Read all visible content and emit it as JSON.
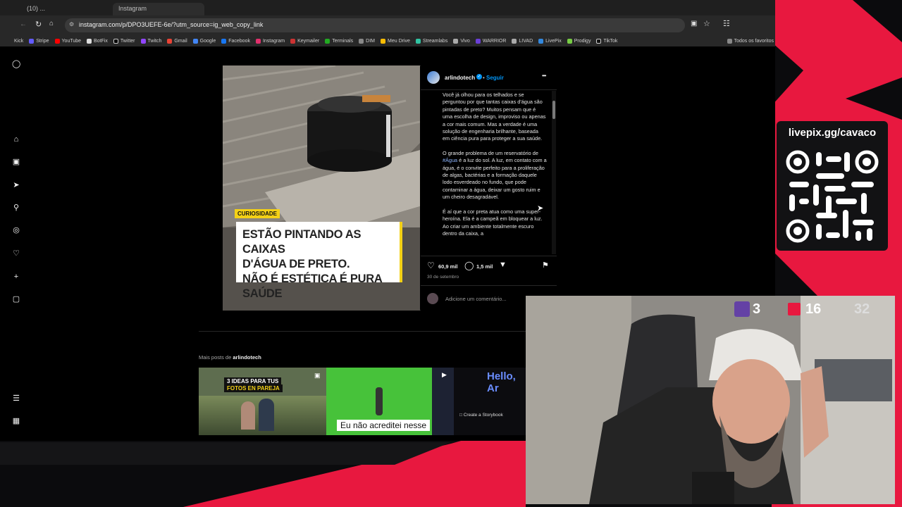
{
  "browser": {
    "tabs": [
      "(10) ...",
      "Instagram"
    ],
    "url": "instagram.com/p/DPO3UEFE-6e/?utm_source=ig_web_copy_link",
    "bookmarks": [
      "Kick",
      "Stripe",
      "YouTube",
      "BotFix",
      "Twitter",
      "Twitch",
      "Gmail",
      "Google",
      "Facebook",
      "Instagram",
      "Keymailer",
      "Terminals",
      "DIM",
      "Meu Drive",
      "Streamlabs",
      "Vivo",
      "WARRIOR",
      "LIVAD",
      "LivePix",
      "Prodigy",
      "TikTok"
    ],
    "all_favorites": "Todos os favoritos"
  },
  "post": {
    "username": "arlindotech",
    "follow": "Seguir",
    "more": "•••",
    "image_tag": "CURIOSIDADE",
    "image_headline_1": "ESTÃO PINTANDO AS CAIXAS",
    "image_headline_2": "D'ÁGUA DE PRETO.",
    "image_headline_3": "NÃO É ESTÉTICA É PURA SAÚDE",
    "caption_p1": "Você já olhou para os telhados e se perguntou por que tantas caixas d'água são pintadas de preto? Muitos pensam que é uma escolha de design, improviso ou apenas a cor mais comum. Mas a verdade é uma solução de engenharia brilhante, baseada em ciência pura para proteger a sua saúde.",
    "caption_p2_a": "O grande problema de um reservatório de ",
    "caption_p2_tag": "#Água",
    "caption_p2_b": " é a luz do sol. A luz, em contato com a água, é o convite perfeito para a proliferação de algas, bactérias e a formação daquele lodo esverdeado no fundo, que pode contaminar a água, deixar um gosto ruim e um cheiro desagradável.",
    "caption_p3": "É aí que a cor preta atua como uma super-heroína. Ela é a campeã em bloquear a luz. Ao criar um ambiente totalmente escuro dentro da caixa, a",
    "likes": "60,9 mil",
    "comments": "1,5 mil",
    "date": "30 de setembro",
    "comment_placeholder": "Adicione um comentário..."
  },
  "more_posts": {
    "label_prefix": "Mais posts de ",
    "label_user": "arlindotech",
    "thumb1_text_1": "3 IDEAS PARA TUS",
    "thumb1_text_2": "FOTOS EN PAREJA",
    "thumb3_text": "Hello, Ar",
    "storybook": "Create a Storybook"
  },
  "subtitle": "Eu não acreditei nesse",
  "overlay": {
    "livepix": "livepix.gg/cavaco",
    "twitch_count": "3",
    "calendar_count": "16",
    "other_count": "32"
  },
  "colors": {
    "accent": "#e8183f",
    "ig_blue": "#0095f6",
    "hashtag": "#e0f1ff"
  }
}
